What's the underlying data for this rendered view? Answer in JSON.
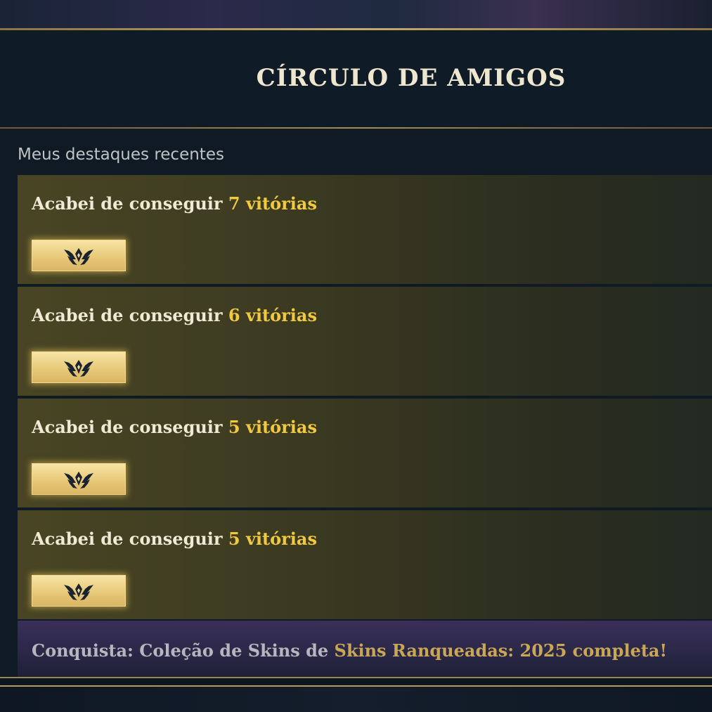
{
  "title": "CÍRCULO DE AMIGOS",
  "section_label": "Meus destaques recentes",
  "highlights": [
    {
      "prefix": "Acabei de conseguir ",
      "highlight": "7 vitórias",
      "badge_icon": "wings-emblem-icon"
    },
    {
      "prefix": "Acabei de conseguir ",
      "highlight": "6 vitórias",
      "badge_icon": "wings-emblem-icon"
    },
    {
      "prefix": "Acabei de conseguir ",
      "highlight": "5 vitórias",
      "badge_icon": "wings-emblem-icon"
    },
    {
      "prefix": "Acabei de conseguir ",
      "highlight": "5 vitórias",
      "badge_icon": "wings-emblem-icon"
    }
  ],
  "achievement": {
    "prefix": "Conquista: Coleção de Skins de ",
    "highlight": "Skins Ranqueadas: 2025 completa!"
  },
  "colors": {
    "accent_gold": "#f0c93e",
    "title_text": "#efe6cf",
    "border_gold": "#c8aa6e",
    "card_olive": "#494524",
    "achievement_purple": "#3a2f5a",
    "badge_gold": "#e9cc7c"
  }
}
